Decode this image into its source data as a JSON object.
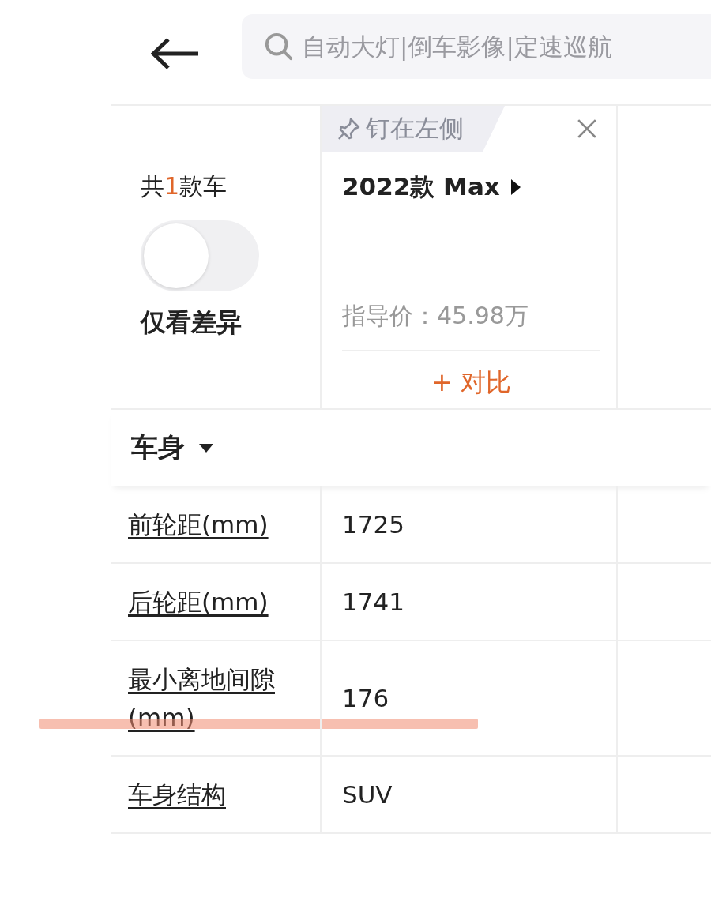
{
  "search": {
    "placeholder": "自动大灯|倒车影像|定速巡航"
  },
  "summary": {
    "prefix": "共",
    "count": "1",
    "suffix": "款车"
  },
  "diff_toggle": {
    "label": "仅看差异",
    "on": false
  },
  "car": {
    "pin_label": "钉在左侧",
    "name": "2022款 Max",
    "price": "指导价：45.98万",
    "compare": "+ 对比"
  },
  "section": {
    "title": "车身",
    "expanded": true
  },
  "rows": [
    {
      "label": "前轮距(mm)",
      "value": "1725",
      "highlighted": false
    },
    {
      "label": "后轮距(mm)",
      "value": "1741",
      "highlighted": false
    },
    {
      "label": "最小离地间隙(mm)",
      "value": "176",
      "highlighted": true
    },
    {
      "label": "车身结构",
      "value": "SUV",
      "highlighted": false
    }
  ]
}
